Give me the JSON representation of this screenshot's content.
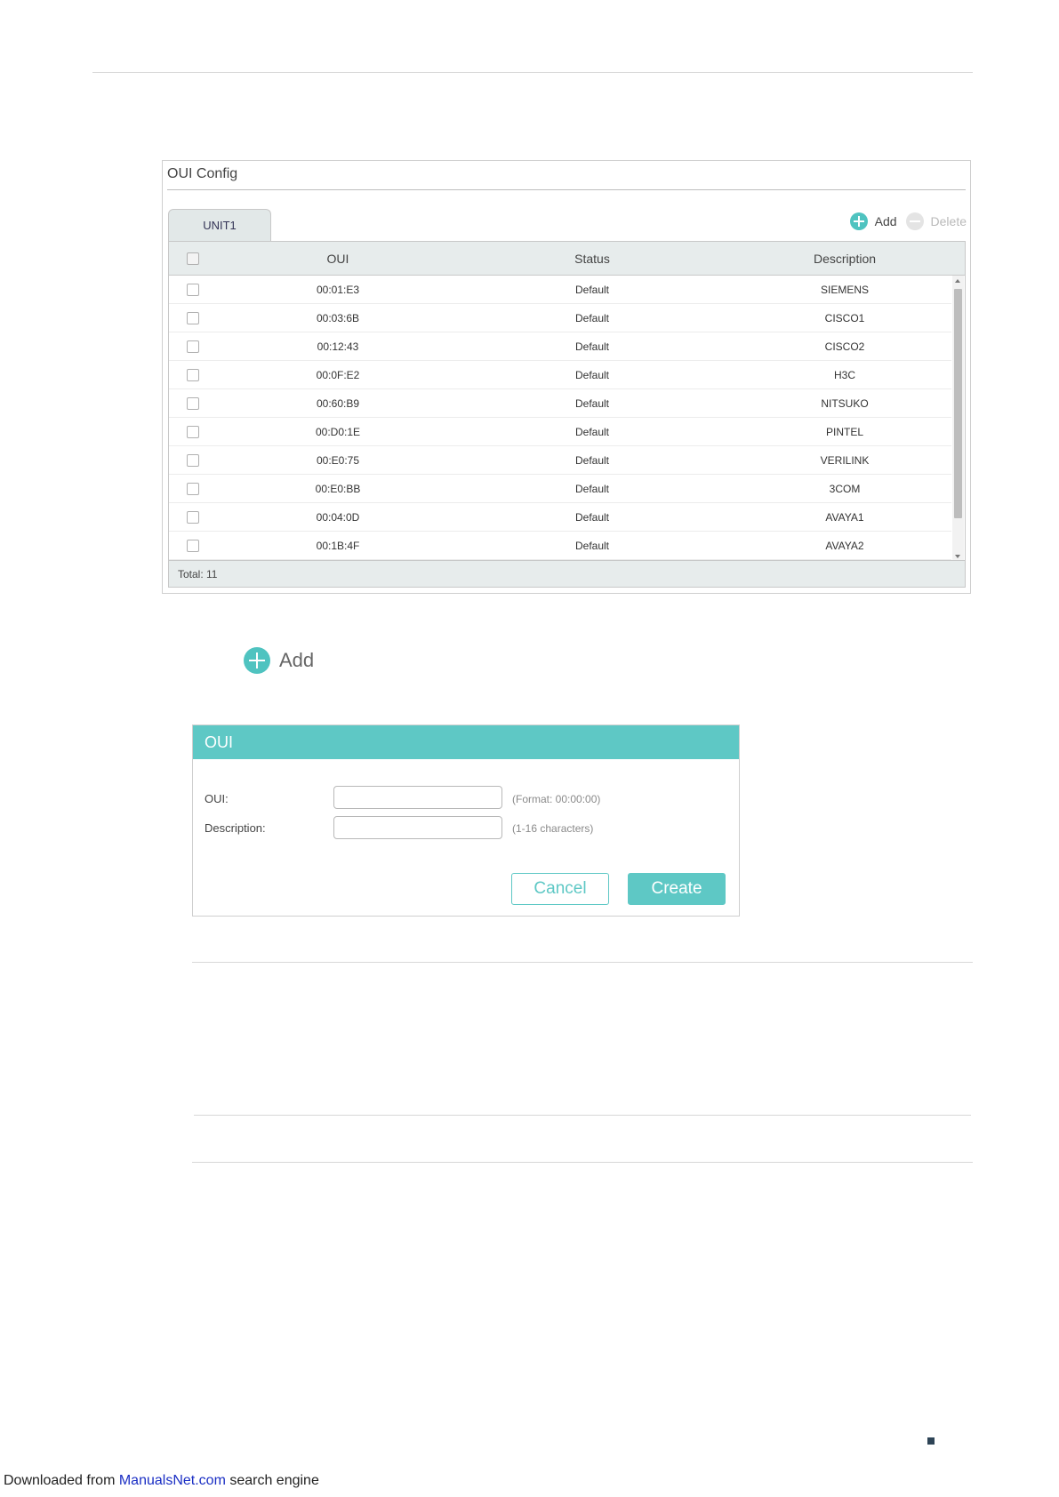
{
  "panel": {
    "title": "OUI Config",
    "tab": "UNIT1",
    "toolbar": {
      "add_label": "Add",
      "delete_label": "Delete"
    },
    "columns": {
      "oui": "OUI",
      "status": "Status",
      "description": "Description"
    },
    "rows": [
      {
        "oui": "00:01:E3",
        "status": "Default",
        "description": "SIEMENS"
      },
      {
        "oui": "00:03:6B",
        "status": "Default",
        "description": "CISCO1"
      },
      {
        "oui": "00:12:43",
        "status": "Default",
        "description": "CISCO2"
      },
      {
        "oui": "00:0F:E2",
        "status": "Default",
        "description": "H3C"
      },
      {
        "oui": "00:60:B9",
        "status": "Default",
        "description": "NITSUKO"
      },
      {
        "oui": "00:D0:1E",
        "status": "Default",
        "description": "PINTEL"
      },
      {
        "oui": "00:E0:75",
        "status": "Default",
        "description": "VERILINK"
      },
      {
        "oui": "00:E0:BB",
        "status": "Default",
        "description": "3COM"
      },
      {
        "oui": "00:04:0D",
        "status": "Default",
        "description": "AVAYA1"
      },
      {
        "oui": "00:1B:4F",
        "status": "Default",
        "description": "AVAYA2"
      }
    ],
    "total_label": "Total: 11"
  },
  "add_button": {
    "label": "Add"
  },
  "dialog": {
    "title": "OUI",
    "oui_label": "OUI:",
    "oui_value": "",
    "oui_hint": "(Format: 00:00:00)",
    "description_label": "Description:",
    "description_value": "",
    "description_hint": "(1-16 characters)",
    "cancel_label": "Cancel",
    "create_label": "Create"
  },
  "footer": {
    "prefix": "Downloaded from ",
    "link": "ManualsNet.com",
    "suffix": " search engine"
  },
  "colors": {
    "accent": "#5ec8c5",
    "icon_teal": "#4fc3c0",
    "header_bg": "#e7ecec",
    "link": "#1b2fc4"
  },
  "icons": {
    "add": "plus-circle-icon",
    "delete": "minus-circle-icon"
  }
}
